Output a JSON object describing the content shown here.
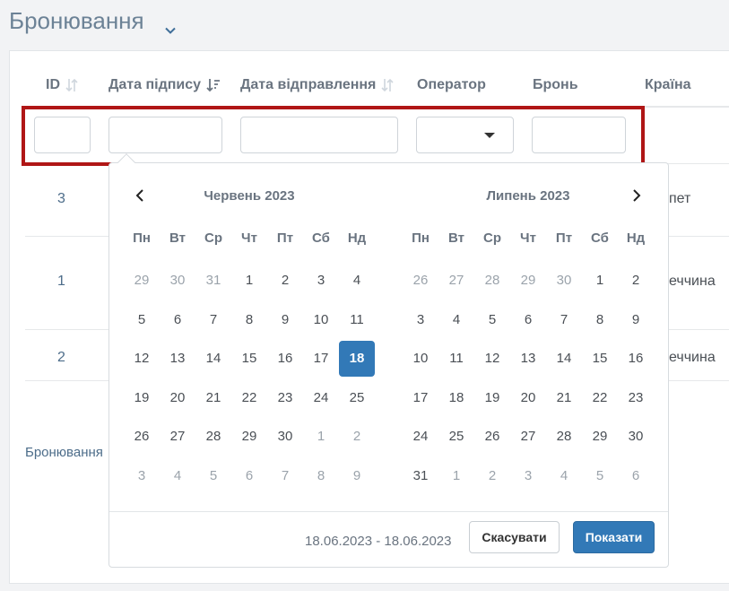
{
  "page": {
    "title": "Бронювання"
  },
  "table": {
    "columns": [
      {
        "label": "ID",
        "sort": "none"
      },
      {
        "label": "Дата підпису",
        "sort": "active"
      },
      {
        "label": "Дата відправлення",
        "sort": "none"
      },
      {
        "label": "Оператор",
        "sort": ""
      },
      {
        "label": "Бронь",
        "sort": ""
      },
      {
        "label": "Країна",
        "sort": ""
      }
    ],
    "rows": [
      {
        "id": "3",
        "country": "пет"
      },
      {
        "id": "1",
        "country": "еччина"
      },
      {
        "id": "2",
        "country": "еччина"
      }
    ],
    "footer": "Бронювання"
  },
  "datepicker": {
    "weekdays": [
      "Пн",
      "Вт",
      "Ср",
      "Чт",
      "Пт",
      "Сб",
      "Нд"
    ],
    "left": {
      "title": "Червень 2023",
      "days": [
        [
          "29",
          "30",
          "31",
          "1",
          "2",
          "3",
          "4"
        ],
        [
          "5",
          "6",
          "7",
          "8",
          "9",
          "10",
          "11"
        ],
        [
          "12",
          "13",
          "14",
          "15",
          "16",
          "17",
          "18"
        ],
        [
          "19",
          "20",
          "21",
          "22",
          "23",
          "24",
          "25"
        ],
        [
          "26",
          "27",
          "28",
          "29",
          "30",
          "1",
          "2"
        ],
        [
          "3",
          "4",
          "5",
          "6",
          "7",
          "8",
          "9"
        ]
      ],
      "off": [
        [
          0,
          0
        ],
        [
          0,
          1
        ],
        [
          0,
          2
        ],
        [
          4,
          5
        ],
        [
          4,
          6
        ],
        [
          5,
          0
        ],
        [
          5,
          1
        ],
        [
          5,
          2
        ],
        [
          5,
          3
        ],
        [
          5,
          4
        ],
        [
          5,
          5
        ],
        [
          5,
          6
        ]
      ],
      "selected": [
        2,
        6
      ]
    },
    "right": {
      "title": "Липень 2023",
      "days": [
        [
          "26",
          "27",
          "28",
          "29",
          "30",
          "1",
          "2"
        ],
        [
          "3",
          "4",
          "5",
          "6",
          "7",
          "8",
          "9"
        ],
        [
          "10",
          "11",
          "12",
          "13",
          "14",
          "15",
          "16"
        ],
        [
          "17",
          "18",
          "19",
          "20",
          "21",
          "22",
          "23"
        ],
        [
          "24",
          "25",
          "26",
          "27",
          "28",
          "29",
          "30"
        ],
        [
          "31",
          "1",
          "2",
          "3",
          "4",
          "5",
          "6"
        ]
      ],
      "off": [
        [
          0,
          0
        ],
        [
          0,
          1
        ],
        [
          0,
          2
        ],
        [
          0,
          3
        ],
        [
          0,
          4
        ],
        [
          5,
          1
        ],
        [
          5,
          2
        ],
        [
          5,
          3
        ],
        [
          5,
          4
        ],
        [
          5,
          5
        ],
        [
          5,
          6
        ]
      ],
      "selected": null
    },
    "range_text": "18.06.2023 - 18.06.2023",
    "cancel_label": "Скасувати",
    "apply_label": "Показати"
  },
  "colors": {
    "accent": "#3279b7",
    "highlight_border": "#b01616"
  }
}
